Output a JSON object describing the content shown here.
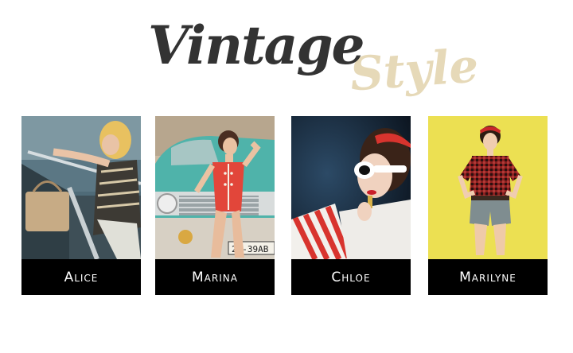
{
  "logo": {
    "word_primary": "Vintage",
    "word_secondary": "Style",
    "primary_color": "#333333",
    "secondary_color": "#e6d9b8"
  },
  "gallery": {
    "cards": [
      {
        "name": "Alice",
        "photo_icon": "woman-in-convertible-photo"
      },
      {
        "name": "Marina",
        "photo_icon": "woman-red-swimsuit-car-photo"
      },
      {
        "name": "Chloe",
        "photo_icon": "woman-lipstick-sunglasses-photo"
      },
      {
        "name": "Marilyne",
        "photo_icon": "woman-plaid-shirt-yellow-photo"
      }
    ],
    "caption_bg": "#000000",
    "caption_color": "#ffffff"
  }
}
